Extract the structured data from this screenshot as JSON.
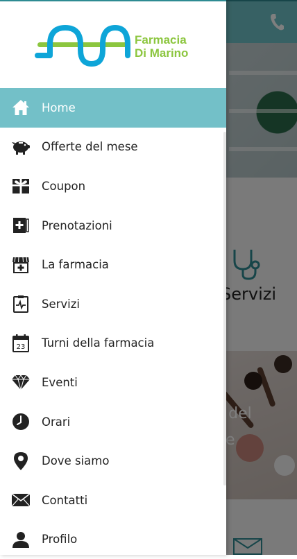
{
  "drawer": {
    "logo": {
      "line1": "Farmacia",
      "line2": "Di Marino",
      "colors": {
        "primary": "#0ea5d8",
        "secondary": "#8cc63f"
      }
    },
    "items": [
      {
        "label": "Home",
        "icon": "home-icon",
        "active": true
      },
      {
        "label": "Offerte del mese",
        "icon": "piggy-bank-icon"
      },
      {
        "label": "Coupon",
        "icon": "gift-icon"
      },
      {
        "label": "Prenotazioni",
        "icon": "medical-book-icon"
      },
      {
        "label": "La farmacia",
        "icon": "pharmacy-store-icon"
      },
      {
        "label": "Servizi",
        "icon": "clipboard-pulse-icon"
      },
      {
        "label": "Turni della farmacia",
        "icon": "calendar-icon",
        "calendar_day": "23"
      },
      {
        "label": "Eventi",
        "icon": "diamond-icon"
      },
      {
        "label": "Orari",
        "icon": "clock-icon"
      },
      {
        "label": "Dove siamo",
        "icon": "map-pin-icon"
      },
      {
        "label": "Contatti",
        "icon": "envelope-icon"
      },
      {
        "label": "Profilo",
        "icon": "user-icon"
      }
    ]
  },
  "background": {
    "services_title": "Servizi",
    "offers_title": "te del\nese"
  },
  "colors": {
    "accent": "#73c0c8",
    "topbar": "#6fc2c9",
    "logo_blue": "#0ea5d8",
    "logo_green": "#8cc63f"
  }
}
